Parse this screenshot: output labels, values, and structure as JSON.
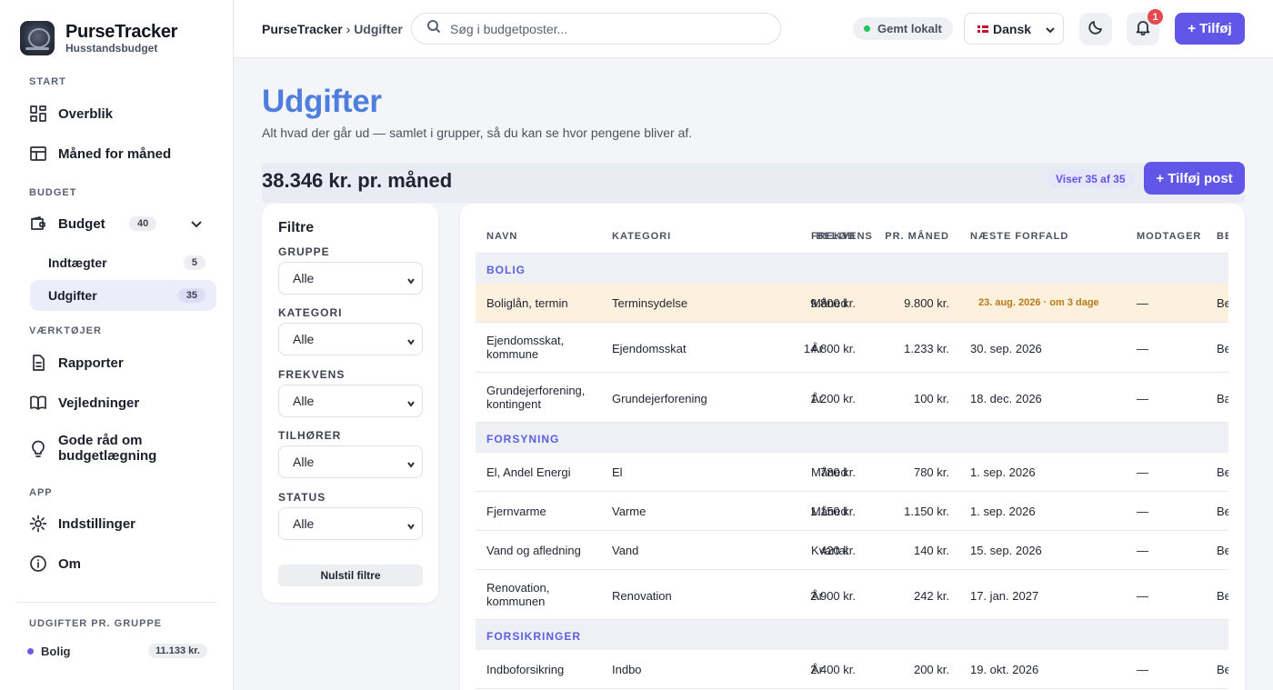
{
  "brand": {
    "name": "PurseTracker",
    "subtitle": "Husstandsbudget"
  },
  "sidebar": {
    "sections": {
      "start": "START",
      "budget": "BUDGET",
      "tools": "VÆRKTØJER",
      "app": "APP",
      "groups": "UDGIFTER PR. GRUPPE"
    },
    "items": {
      "overview": "Overblik",
      "monthly": "Måned for måned",
      "budget": "Budget",
      "budget_count": "40",
      "income": "Indtægter",
      "income_count": "5",
      "expenses": "Udgifter",
      "expenses_count": "35",
      "reports": "Rapporter",
      "guides": "Vejledninger",
      "tips_line1": "Gode råd om",
      "tips_line2": "budgetlægning",
      "settings": "Indstillinger",
      "about": "Om"
    },
    "group_summary": {
      "name": "Bolig",
      "amount": "11.133 kr.",
      "color": "#6b5be6"
    }
  },
  "topbar": {
    "breadcrumb_root": "PurseTracker",
    "breadcrumb_sep": "›",
    "breadcrumb_current": "Udgifter",
    "search_placeholder": "Søg i budgetposter...",
    "saved_status": "Gemt lokalt",
    "language": "Dansk",
    "notification_count": "1",
    "add_label": "+ Tilføj"
  },
  "page": {
    "title": "Udgifter",
    "subtitle": "Alt hvad der går ud — samlet i grupper, så du kan se hvor pengene bliver af.",
    "monthly_total": "38.346 kr. pr. måned",
    "showing": "Viser 35 af 35",
    "add_post": "+ Tilføj post"
  },
  "filters": {
    "title": "Filtre",
    "group_label": "GRUPPE",
    "group_value": "Alle",
    "category_label": "KATEGORI",
    "category_value": "Alle",
    "frequency_label": "FREKVENS",
    "frequency_value": "Alle",
    "owner_label": "TILHØRER",
    "owner_value": "Alle",
    "status_label": "STATUS",
    "status_value": "Alle",
    "reset": "Nulstil filtre"
  },
  "table": {
    "headers": [
      "NAVN",
      "KATEGORI",
      "BELØB",
      "FREKVENS",
      "PR. MÅNED",
      "NÆSTE FORFALD",
      "MODTAGER",
      "BE"
    ],
    "groups": [
      {
        "name": "BOLIG",
        "rows": [
          {
            "name1": "Boliglån, termin",
            "name2": "",
            "category": "Terminsydelse",
            "amount": "9.800 kr.",
            "frequency": "Måned",
            "monthly": "9.800 kr.",
            "due": "23. aug. 2026 · om 3 dage",
            "recipient": "—",
            "extra": "Be"
          },
          {
            "name1": "Ejendomsskat,",
            "name2": "kommune",
            "category": "Ejendomsskat",
            "amount": "14.800 kr.",
            "frequency": "År",
            "monthly": "1.233 kr.",
            "due": "30. sep. 2026",
            "recipient": "—",
            "extra": "Be"
          },
          {
            "name1": "Grundejerforening,",
            "name2": "kontingent",
            "category": "Grundejerforening",
            "amount": "1.200 kr.",
            "frequency": "År",
            "monthly": "100 kr.",
            "due": "18. dec. 2026",
            "recipient": "—",
            "extra": "Ba"
          }
        ]
      },
      {
        "name": "FORSYNING",
        "rows": [
          {
            "name1": "El, Andel Energi",
            "name2": "",
            "category": "El",
            "amount": "780 kr.",
            "frequency": "Måned",
            "monthly": "780 kr.",
            "due": "1. sep. 2026",
            "recipient": "—",
            "extra": "Be"
          },
          {
            "name1": "Fjernvarme",
            "name2": "",
            "category": "Varme",
            "amount": "1.150 kr.",
            "frequency": "Måned",
            "monthly": "1.150 kr.",
            "due": "1. sep. 2026",
            "recipient": "—",
            "extra": "Be"
          },
          {
            "name1": "Vand og afledning",
            "name2": "",
            "category": "Vand",
            "amount": "420 kr.",
            "frequency": "Kvartal",
            "monthly": "140 kr.",
            "due": "15. sep. 2026",
            "recipient": "—",
            "extra": "Be"
          },
          {
            "name1": "Renovation,",
            "name2": "kommunen",
            "category": "Renovation",
            "amount": "2.900 kr.",
            "frequency": "År",
            "monthly": "242 kr.",
            "due": "17. jan. 2027",
            "recipient": "—",
            "extra": "Be"
          }
        ]
      },
      {
        "name": "FORSIKRINGER",
        "rows": [
          {
            "name1": "Indboforsikring",
            "name2": "",
            "category": "Indbo",
            "amount": "2.400 kr.",
            "frequency": "År",
            "monthly": "200 kr.",
            "due": "19. okt. 2026",
            "recipient": "—",
            "extra": "Be"
          }
        ]
      }
    ]
  }
}
